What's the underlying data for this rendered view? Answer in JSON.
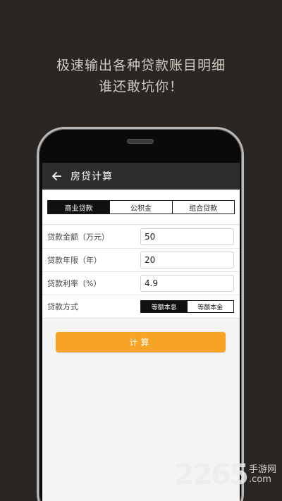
{
  "promo": {
    "line1": "极速输出各种贷款账目明细",
    "line2": "谁还敢坑你！"
  },
  "appbar": {
    "back_icon": "arrow-left-icon",
    "title": "房贷计算"
  },
  "tabs": [
    {
      "label": "商业贷款",
      "active": true
    },
    {
      "label": "公积金",
      "active": false
    },
    {
      "label": "组合贷款",
      "active": false
    }
  ],
  "form": {
    "amount": {
      "label": "贷款金额（万元）",
      "value": "50"
    },
    "years": {
      "label": "贷款年限（年）",
      "value": "20"
    },
    "rate": {
      "label": "贷款利率（%）",
      "value": "4.9"
    },
    "method": {
      "label": "贷款方式",
      "options": [
        {
          "label": "等额本息",
          "active": true
        },
        {
          "label": "等额本金",
          "active": false
        }
      ]
    }
  },
  "calculate_label": "计算",
  "watermark": {
    "number": "2265",
    "text": "手游网",
    "domain": ".com"
  },
  "colors": {
    "background": "#2b2622",
    "appbar": "#2d2d2d",
    "accent": "#f7a325"
  }
}
